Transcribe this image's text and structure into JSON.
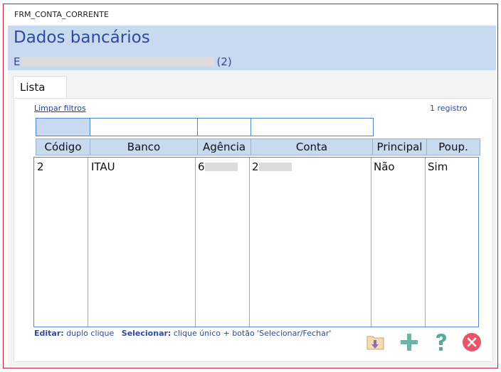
{
  "window": {
    "title": "FRM_CONTA_CORRENTE"
  },
  "header": {
    "title": "Dados bancários",
    "subtitle_prefix": "E",
    "subtitle_suffix": "(2)"
  },
  "tabs": [
    {
      "label": "Lista"
    }
  ],
  "toolbar": {
    "clear_filters": "Limpar filtros",
    "record_count": "1 registro"
  },
  "columns": [
    "Código",
    "Banco",
    "Agência",
    "Conta",
    "Principal",
    "Poup."
  ],
  "rows": [
    {
      "codigo": "2",
      "banco": "ITAU",
      "agencia_prefix": "6",
      "conta_prefix": "2",
      "principal": "Não",
      "poupanca": "Sim"
    }
  ],
  "footer": {
    "edit_label": "Editar:",
    "edit_text": "duplo clique",
    "select_label": "Selecionar:",
    "select_text": "clique único + botão 'Selecionar/Fechar'"
  },
  "buttons": [
    {
      "name": "select-close-button",
      "icon": "folder-arrow-icon"
    },
    {
      "name": "add-button",
      "icon": "plus-icon"
    },
    {
      "name": "help-button",
      "icon": "question-icon"
    },
    {
      "name": "close-button",
      "icon": "close-circle-icon"
    }
  ],
  "colors": {
    "accent": "#2d4aa0",
    "header_bg": "#c9d9ef",
    "border": "#c0202e",
    "close": "#e8556a",
    "add": "#4fae9c"
  }
}
